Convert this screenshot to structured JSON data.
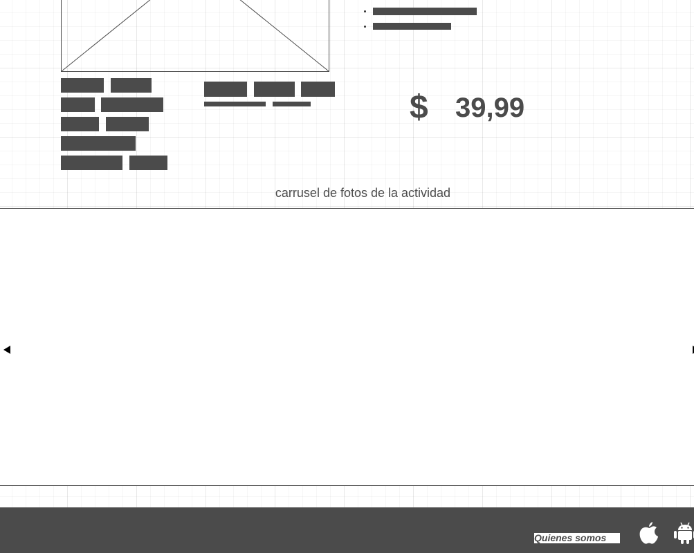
{
  "price": {
    "currency": "$",
    "amount": "39,99"
  },
  "carousel": {
    "caption": "carrusel de fotos de la actividad",
    "prev_icon": "triangle-left-icon",
    "next_icon": "triangle-right-icon"
  },
  "footer": {
    "about_label": "Quienes somos",
    "apple_icon": "apple-icon",
    "android_icon": "android-icon"
  },
  "colors": {
    "primary_dark": "#4b4b4b",
    "background": "#ffffff"
  }
}
